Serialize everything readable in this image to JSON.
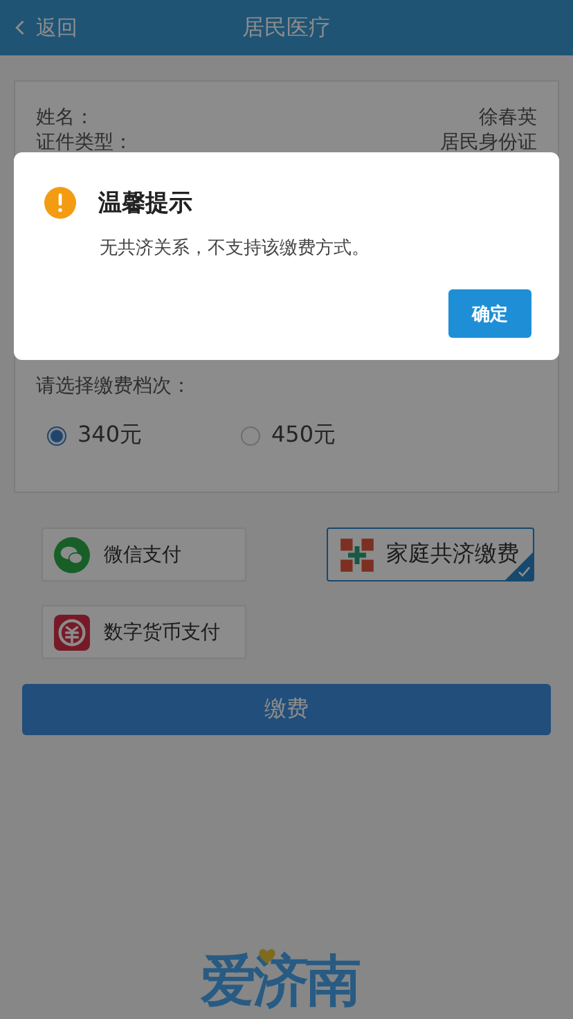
{
  "header": {
    "back": "返回",
    "title": "居民医疗"
  },
  "info_rows": [
    {
      "label": "姓名：",
      "value": "徐春英"
    },
    {
      "label": "证件类型：",
      "value": "居民身份证"
    }
  ],
  "tier": {
    "label": "请选择缴费档次：",
    "options": [
      {
        "label": "340元",
        "selected": true
      },
      {
        "label": "450元",
        "selected": false
      }
    ]
  },
  "payment_methods": [
    {
      "label": "微信支付",
      "selected": false
    },
    {
      "label": "家庭共济缴费",
      "selected": true
    },
    {
      "label": "数字货币支付",
      "selected": false
    }
  ],
  "pay_button": "缴费",
  "logo": "爱济南",
  "dialog": {
    "title": "温馨提示",
    "message": "无共济关系，不支持该缴费方式。",
    "button": "确定"
  }
}
